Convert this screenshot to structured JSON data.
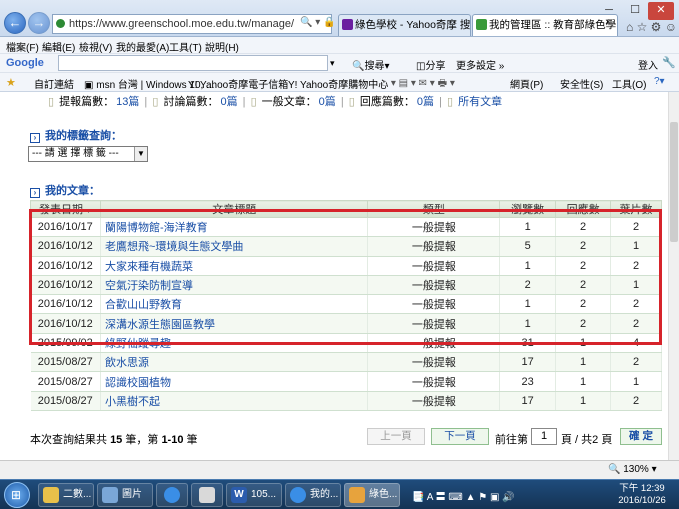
{
  "browser": {
    "url": "https://www.greenschool.moe.edu.tw/manage/",
    "tabs": [
      {
        "label": "綠色學校 - Yahoo奇摩 搜尋結果"
      },
      {
        "label": "我的管理區 :: 教育部綠色學..."
      }
    ],
    "menu": [
      "檔案(F)",
      "編輯(E)",
      "檢視(V)",
      "我的最愛(A)",
      "工具(T)",
      "說明(H)"
    ],
    "google": {
      "brand": "Google",
      "search_label": "搜尋",
      "share_label": "分享",
      "more_label": "更多設定 »",
      "login_label": "登入"
    },
    "favorites": [
      "自訂連結",
      "msn 台灣 | Windows 10, ...",
      "Yahoo奇摩電子信箱",
      "Yahoo奇摩購物中心"
    ],
    "favbar_right": [
      "網頁(P)",
      "安全性(S)",
      "工具(O)"
    ]
  },
  "stats": {
    "items": [
      {
        "label": "提報篇數：",
        "value": "13篇"
      },
      {
        "label": "討論篇數：",
        "value": "0篇"
      },
      {
        "label": "一般文章：",
        "value": "0篇"
      },
      {
        "label": "回應篇數：",
        "value": "0篇"
      }
    ],
    "all_link": "所有文章"
  },
  "tags": {
    "heading": "我的標籤查詢：",
    "select_value": "--- 請 選 擇 標 籤 ---"
  },
  "articles": {
    "heading": "我的文章：",
    "columns": [
      "發表日期",
      "文章標題",
      "類型",
      "瀏覽數",
      "回應數",
      "葉片數"
    ],
    "rows": [
      {
        "date": "2016/10/17",
        "title": "蘭陽博物館-海洋教育",
        "type": "一般提報",
        "views": "1",
        "replies": "2",
        "leaves": "2"
      },
      {
        "date": "2016/10/12",
        "title": "老鷹想飛~環境與生態文學曲",
        "type": "一般提報",
        "views": "5",
        "replies": "2",
        "leaves": "1"
      },
      {
        "date": "2016/10/12",
        "title": "大家來種有機蔬菜",
        "type": "一般提報",
        "views": "1",
        "replies": "2",
        "leaves": "2"
      },
      {
        "date": "2016/10/12",
        "title": "空氣汙染防制宣導",
        "type": "一般提報",
        "views": "2",
        "replies": "2",
        "leaves": "1"
      },
      {
        "date": "2016/10/12",
        "title": "合歡山山野教育",
        "type": "一般提報",
        "views": "1",
        "replies": "2",
        "leaves": "2"
      },
      {
        "date": "2016/10/12",
        "title": "深溝水源生態園區教學",
        "type": "一般提報",
        "views": "1",
        "replies": "2",
        "leaves": "2"
      },
      {
        "date": "2015/09/02",
        "title": "綠野仙蹤尋趣",
        "type": "一般提報",
        "views": "31",
        "replies": "1",
        "leaves": "4"
      },
      {
        "date": "2015/08/27",
        "title": "飲水思源",
        "type": "一般提報",
        "views": "17",
        "replies": "1",
        "leaves": "2"
      },
      {
        "date": "2015/08/27",
        "title": "認識校園植物",
        "type": "一般提報",
        "views": "23",
        "replies": "1",
        "leaves": "1"
      },
      {
        "date": "2015/08/27",
        "title": "小黑樹不起",
        "type": "一般提報",
        "views": "17",
        "replies": "1",
        "leaves": "2"
      }
    ]
  },
  "pager": {
    "summary_prefix": "本次查詢結果共",
    "total": "15",
    "summary_mid": "筆，第",
    "range": "1-10",
    "summary_suffix": "筆",
    "prev_label": "上一頁",
    "next_label": "下一頁",
    "goto_prefix": "前往第",
    "page_value": "1",
    "goto_suffix": "頁 / 共2 頁",
    "confirm_label": "確 定"
  },
  "status": {
    "zoom": "130%"
  },
  "taskbar": {
    "items": [
      "二數...",
      "圖片",
      "",
      "105...",
      "我的...",
      "綠色..."
    ],
    "time": "下午 12:39",
    "date": "2016/10/26",
    "ime": "A"
  },
  "colors": {
    "accent": "#1a4fa6",
    "highlight": "#d6232a",
    "table_header": "#d7e4d2"
  }
}
